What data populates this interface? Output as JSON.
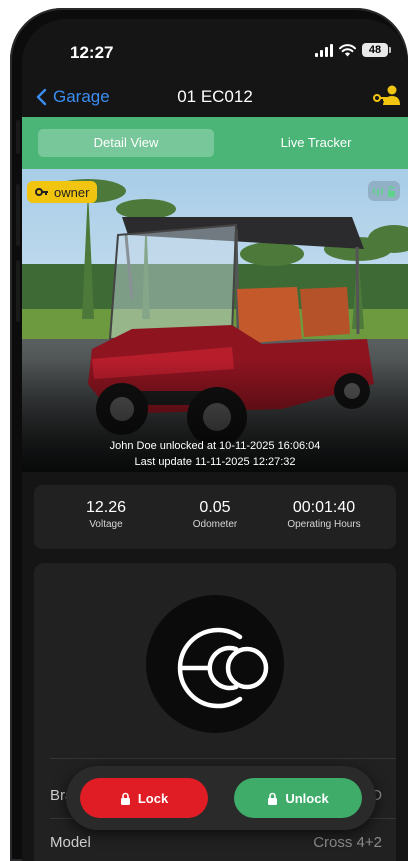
{
  "status_bar": {
    "time": "12:27",
    "battery": "48"
  },
  "nav": {
    "back_label": "Garage",
    "title": "01 EC012"
  },
  "tabs": [
    {
      "label": "Detail View",
      "active": true
    },
    {
      "label": "Live Tracker",
      "active": false
    }
  ],
  "hero": {
    "badge": "owner",
    "unlock_text": "John Doe unlocked at 10-11-2025 16:06:04",
    "update_text": "Last update 11-11-2025 12:27:32"
  },
  "stats": [
    {
      "value": "12.26",
      "label": "Voltage"
    },
    {
      "value": "0.05",
      "label": "Odometer"
    },
    {
      "value": "00:01:40",
      "label": "Operating Hours"
    }
  ],
  "details": [
    {
      "label": "Brand",
      "value": "ECO"
    },
    {
      "label": "Model",
      "value": "Cross 4+2"
    }
  ],
  "actions": {
    "lock": "Lock",
    "unlock": "Unlock"
  },
  "colors": {
    "accent_green": "#4bb578",
    "lock_red": "#e01c24",
    "unlock_green": "#3fac6a",
    "owner_yellow": "#f1c40f",
    "link_blue": "#3b8df2"
  }
}
